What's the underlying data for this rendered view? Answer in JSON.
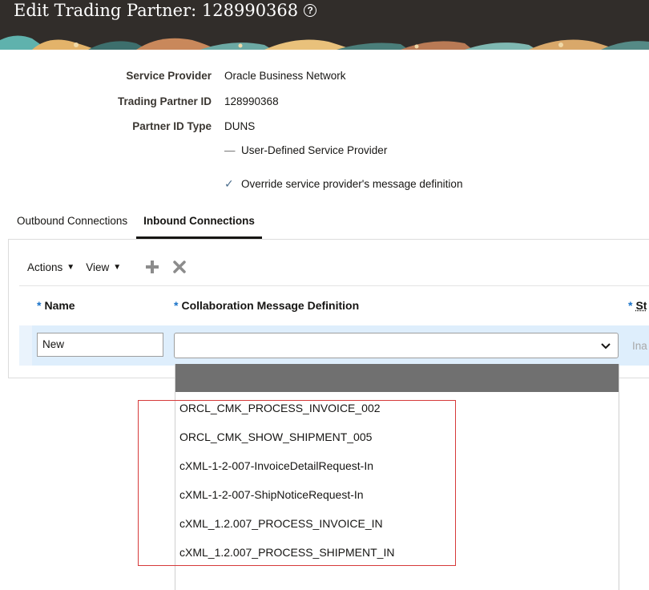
{
  "header": {
    "title": "Edit Trading Partner: 128990368",
    "help_symbol": "?"
  },
  "fields": [
    {
      "label": "Service Provider",
      "value": "Oracle Business Network"
    },
    {
      "label": "Trading Partner ID",
      "value": "128990368"
    },
    {
      "label": "Partner ID Type",
      "value": "DUNS"
    }
  ],
  "checkboxes": {
    "user_defined": {
      "label": "User-Defined Service Provider",
      "checked": false
    },
    "override": {
      "label": "Override service provider's message definition",
      "checked": true
    }
  },
  "tabs": [
    {
      "label": "Outbound Connections",
      "active": false
    },
    {
      "label": "Inbound Connections",
      "active": true
    }
  ],
  "toolbar": {
    "actions_label": "Actions",
    "view_label": "View",
    "add_icon": "plus-icon",
    "delete_icon": "x-icon"
  },
  "table": {
    "required_marker": "*",
    "columns": [
      "Name",
      "Collaboration Message Definition",
      "St"
    ],
    "row": {
      "name_value": "New",
      "definition_value": "",
      "status_value": "Ina"
    }
  },
  "dropdown": {
    "options": [
      "ORCL_CMK_PROCESS_INVOICE_002",
      "ORCL_CMK_SHOW_SHIPMENT_005",
      "cXML-1-2-007-InvoiceDetailRequest-In",
      "cXML-1-2-007-ShipNoticeRequest-In",
      "cXML_1.2.007_PROCESS_INVOICE_IN",
      "cXML_1.2.007_PROCESS_SHIPMENT_IN"
    ]
  },
  "colors": {
    "header_bg": "#312d2a",
    "selected_row": "#deeefc",
    "highlight_option": "#707070",
    "annotation_box": "#d63a3a",
    "required": "#1a73c9"
  }
}
